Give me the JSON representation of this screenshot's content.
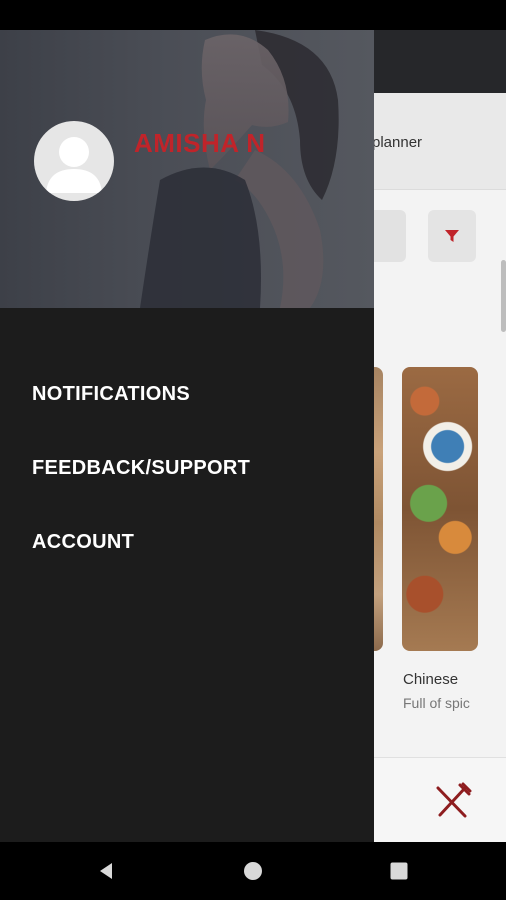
{
  "app": {
    "planner_partial_text": "planner",
    "cards": [
      {
        "title": "Chinese",
        "description": "Full of spic"
      }
    ]
  },
  "drawer": {
    "user_name": "AMISHA N",
    "menu": [
      {
        "label": "NOTIFICATIONS"
      },
      {
        "label": "FEEDBACK/SUPPORT"
      },
      {
        "label": "ACCOUNT"
      }
    ]
  },
  "icons": {
    "avatar": "person-icon",
    "filter": "filter-icon",
    "restaurant": "fork-knife-icon",
    "back": "back-triangle-icon",
    "home": "home-circle-icon",
    "recents": "recents-square-icon"
  },
  "colors": {
    "accent": "#c0242a",
    "drawer_bg": "#1c1c1c",
    "header_bg": "#26272a"
  }
}
